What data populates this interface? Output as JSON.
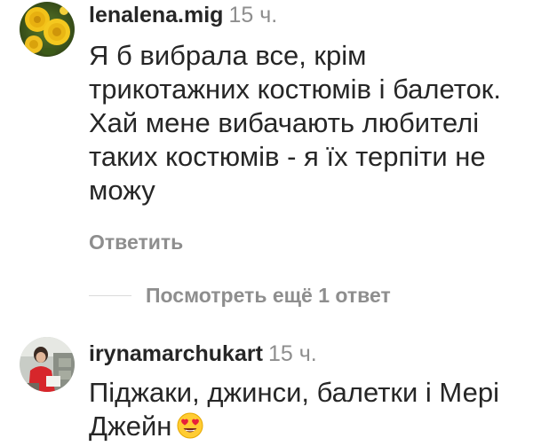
{
  "comments": [
    {
      "avatar_icon": "yellow-roses-avatar",
      "username": "lenalena.mig",
      "time": "15 ч.",
      "text": "Я б вибрала все, крім трикотажних костюмів і балеток. Хай мене вибачають любителі таких костюмів - я їх терпіти не можу",
      "reply_label": "Ответить",
      "more_replies_label": "Посмотреть ещё 1 ответ"
    },
    {
      "avatar_icon": "person-photo-avatar",
      "username": "irynamarchukart",
      "time": "15 ч.",
      "text": "Піджаки, джинси, балетки і Мері Джейн",
      "emoji_icon": "heart-eyes-emoji-icon"
    }
  ],
  "colors": {
    "text": "#262626",
    "secondary": "#8e8e8e",
    "divider": "#dbdbdb"
  }
}
